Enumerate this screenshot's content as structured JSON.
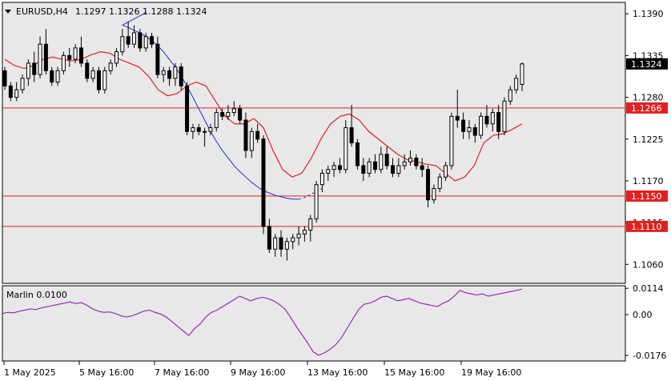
{
  "header": {
    "symbol": "EURUSD,H4",
    "ohlc": "1.1297 1.1326 1.1288 1.1324"
  },
  "colors": {
    "background": "#e8e8e8",
    "bull_candle": "#ffffff",
    "bear_candle": "#000000",
    "ma_fast": "#e02020",
    "ma_slow": "#1f2fd0",
    "level_line": "#e02020",
    "oscillator": "#9c2ab8",
    "current_price_bg": "#000000"
  },
  "chart_data": [
    {
      "type": "candlestick",
      "title": "EURUSD,H4",
      "ylim": [
        1.1035,
        1.1405
      ],
      "y_ticks": [
        "1.1390",
        "1.1335",
        "1.1280",
        "1.1225",
        "1.1170",
        "1.1115",
        "1.1060"
      ],
      "x_ticks": [
        "1 May 2025",
        "5 May 16:00",
        "7 May 16:00",
        "9 May 16:00",
        "13 May 16:00",
        "15 May 16:00",
        "19 May 16:00"
      ],
      "current_price": "1.1324",
      "levels": [
        {
          "value": 1.1266,
          "label": "1.1266"
        },
        {
          "value": 1.115,
          "label": "1.1150"
        },
        {
          "value": 1.111,
          "label": "1.1110"
        }
      ],
      "candles": [
        [
          1.1315,
          1.132,
          1.129,
          1.1295
        ],
        [
          1.1295,
          1.13,
          1.1275,
          1.128
        ],
        [
          1.128,
          1.13,
          1.1275,
          1.129
        ],
        [
          1.129,
          1.131,
          1.1285,
          1.1305
        ],
        [
          1.1305,
          1.133,
          1.1295,
          1.1325
        ],
        [
          1.1325,
          1.134,
          1.13,
          1.131
        ],
        [
          1.131,
          1.136,
          1.1305,
          1.135
        ],
        [
          1.135,
          1.137,
          1.131,
          1.1315
        ],
        [
          1.1315,
          1.132,
          1.1295,
          1.13
        ],
        [
          1.13,
          1.132,
          1.1295,
          1.1315
        ],
        [
          1.1315,
          1.134,
          1.131,
          1.1335
        ],
        [
          1.1335,
          1.1345,
          1.132,
          1.133
        ],
        [
          1.133,
          1.135,
          1.1325,
          1.1345
        ],
        [
          1.1345,
          1.136,
          1.132,
          1.1325
        ],
        [
          1.1325,
          1.133,
          1.13,
          1.1305
        ],
        [
          1.1305,
          1.132,
          1.13,
          1.1315
        ],
        [
          1.1315,
          1.132,
          1.1285,
          1.129
        ],
        [
          1.129,
          1.132,
          1.1285,
          1.1315
        ],
        [
          1.1315,
          1.133,
          1.131,
          1.1325
        ],
        [
          1.1325,
          1.1345,
          1.132,
          1.134
        ],
        [
          1.134,
          1.137,
          1.1335,
          1.136
        ],
        [
          1.136,
          1.138,
          1.1345,
          1.135
        ],
        [
          1.135,
          1.1375,
          1.1345,
          1.1365
        ],
        [
          1.1365,
          1.137,
          1.134,
          1.1345
        ],
        [
          1.1345,
          1.1365,
          1.134,
          1.136
        ],
        [
          1.136,
          1.1365,
          1.1345,
          1.135
        ],
        [
          1.135,
          1.136,
          1.1305,
          1.131
        ],
        [
          1.131,
          1.132,
          1.13,
          1.1315
        ],
        [
          1.1315,
          1.132,
          1.1295,
          1.1305
        ],
        [
          1.1305,
          1.1325,
          1.1295,
          1.132
        ],
        [
          1.132,
          1.1325,
          1.129,
          1.1295
        ],
        [
          1.1295,
          1.13,
          1.123,
          1.1235
        ],
        [
          1.1235,
          1.1245,
          1.1225,
          1.124
        ],
        [
          1.124,
          1.1245,
          1.123,
          1.1235
        ],
        [
          1.1235,
          1.124,
          1.1215,
          1.1235
        ],
        [
          1.1235,
          1.1245,
          1.123,
          1.124
        ],
        [
          1.124,
          1.1265,
          1.1235,
          1.126
        ],
        [
          1.126,
          1.1265,
          1.125,
          1.1255
        ],
        [
          1.1255,
          1.127,
          1.125,
          1.126
        ],
        [
          1.126,
          1.1275,
          1.1255,
          1.1265
        ],
        [
          1.1265,
          1.127,
          1.1245,
          1.125
        ],
        [
          1.125,
          1.126,
          1.12,
          1.121
        ],
        [
          1.121,
          1.124,
          1.12,
          1.1235
        ],
        [
          1.1235,
          1.1245,
          1.122,
          1.1225
        ],
        [
          1.1225,
          1.123,
          1.11,
          1.111
        ],
        [
          1.111,
          1.112,
          1.1075,
          1.108
        ],
        [
          1.108,
          1.11,
          1.107,
          1.1095
        ],
        [
          1.1095,
          1.1105,
          1.107,
          1.108
        ],
        [
          1.108,
          1.1095,
          1.1065,
          1.109
        ],
        [
          1.109,
          1.11,
          1.108,
          1.1095
        ],
        [
          1.1095,
          1.111,
          1.1085,
          1.11
        ],
        [
          1.11,
          1.111,
          1.109,
          1.1105
        ],
        [
          1.1105,
          1.1125,
          1.109,
          1.112
        ],
        [
          1.112,
          1.117,
          1.1115,
          1.1165
        ],
        [
          1.1165,
          1.1185,
          1.1155,
          1.118
        ],
        [
          1.118,
          1.119,
          1.117,
          1.1185
        ],
        [
          1.1185,
          1.1195,
          1.1175,
          1.119
        ],
        [
          1.119,
          1.12,
          1.118,
          1.1185
        ],
        [
          1.1185,
          1.125,
          1.118,
          1.124
        ],
        [
          1.124,
          1.127,
          1.1215,
          1.122
        ],
        [
          1.122,
          1.1225,
          1.1185,
          1.119
        ],
        [
          1.119,
          1.12,
          1.117,
          1.118
        ],
        [
          1.118,
          1.12,
          1.1175,
          1.1195
        ],
        [
          1.1195,
          1.1205,
          1.118,
          1.1185
        ],
        [
          1.1185,
          1.1215,
          1.118,
          1.1205
        ],
        [
          1.1205,
          1.1215,
          1.1185,
          1.119
        ],
        [
          1.119,
          1.12,
          1.1175,
          1.118
        ],
        [
          1.118,
          1.12,
          1.1175,
          1.119
        ],
        [
          1.119,
          1.1205,
          1.1185,
          1.1195
        ],
        [
          1.1195,
          1.121,
          1.119,
          1.12
        ],
        [
          1.12,
          1.1205,
          1.1185,
          1.119
        ],
        [
          1.119,
          1.12,
          1.1175,
          1.1185
        ],
        [
          1.1185,
          1.119,
          1.1135,
          1.1145
        ],
        [
          1.1145,
          1.1165,
          1.114,
          1.116
        ],
        [
          1.116,
          1.118,
          1.1155,
          1.1175
        ],
        [
          1.1175,
          1.1195,
          1.117,
          1.119
        ],
        [
          1.119,
          1.126,
          1.1185,
          1.1255
        ],
        [
          1.1255,
          1.129,
          1.124,
          1.125
        ],
        [
          1.125,
          1.126,
          1.1225,
          1.1235
        ],
        [
          1.1235,
          1.125,
          1.1225,
          1.124
        ],
        [
          1.124,
          1.1245,
          1.122,
          1.123
        ],
        [
          1.123,
          1.126,
          1.1225,
          1.1255
        ],
        [
          1.1255,
          1.127,
          1.124,
          1.1245
        ],
        [
          1.1245,
          1.1265,
          1.1235,
          1.126
        ],
        [
          1.126,
          1.127,
          1.1225,
          1.1235
        ],
        [
          1.1235,
          1.128,
          1.123,
          1.1275
        ],
        [
          1.1275,
          1.1295,
          1.127,
          1.129
        ],
        [
          1.129,
          1.131,
          1.1285,
          1.1305
        ],
        [
          1.1297,
          1.1326,
          1.1288,
          1.1324
        ]
      ],
      "ma_fast": [
        1.133,
        1.1322,
        1.1318,
        1.1322,
        1.133,
        1.1333,
        1.133,
        1.1328,
        1.133,
        1.1336,
        1.134,
        1.1338,
        1.133,
        1.1325,
        1.132,
        1.1308,
        1.129,
        1.1282,
        1.1285,
        1.1295,
        1.13,
        1.1295,
        1.1275,
        1.1255,
        1.1245,
        1.1245,
        1.1252,
        1.124,
        1.121,
        1.1185,
        1.1175,
        1.118,
        1.12,
        1.1225,
        1.1245,
        1.1255,
        1.1258,
        1.125,
        1.1235,
        1.1225,
        1.1215,
        1.1205,
        1.1198,
        1.1195,
        1.1192,
        1.119,
        1.118,
        1.117,
        1.1175,
        1.119,
        1.122,
        1.123,
        1.1232,
        1.1238,
        1.1245
      ],
      "ma_fast_start": 0,
      "ma_slow": [
        1.1375,
        1.1372,
        1.1368,
        1.1365,
        1.136,
        1.1355,
        1.1348,
        1.134,
        1.133,
        1.132,
        1.1308,
        1.1295,
        1.128,
        1.1265,
        1.125,
        1.1235,
        1.1222,
        1.121,
        1.12,
        1.119,
        1.1182,
        1.1175,
        1.1168,
        1.1162,
        1.1157,
        1.1154,
        1.1151,
        1.1149,
        1.1147,
        1.1146,
        1.1146,
        1.1148,
        1.1152,
        1.1156,
        1.116
      ],
      "ma_slow_start": 20,
      "ma_slow_dashed_from": 30
    },
    {
      "type": "line",
      "title": "Marlin 0.0100",
      "ylim": [
        -0.02,
        0.0125
      ],
      "y_ticks": [
        "0.0114",
        "0.00",
        "-0.0176"
      ],
      "values": [
        0.0005,
        0.001,
        0.0008,
        0.0015,
        0.002,
        0.0025,
        0.0022,
        0.003,
        0.0035,
        0.004,
        0.0045,
        0.005,
        0.0055,
        0.0048,
        0.0052,
        0.004,
        0.0025,
        0.0015,
        0.001,
        0.0012,
        0.0005,
        -0.0005,
        -0.001,
        -0.0005,
        0.0005,
        0.0015,
        0.002,
        0.001,
        0.0003,
        -0.001,
        -0.003,
        -0.005,
        -0.007,
        -0.009,
        -0.006,
        -0.004,
        -0.001,
        0.001,
        0.002,
        0.0035,
        0.005,
        0.0065,
        0.008,
        0.007,
        0.006,
        0.007,
        0.0075,
        0.007,
        0.006,
        0.0045,
        0.0025,
        -0.001,
        -0.005,
        -0.0085,
        -0.012,
        -0.016,
        -0.0175,
        -0.0165,
        -0.015,
        -0.013,
        -0.01,
        -0.006,
        -0.002,
        0.002,
        0.0045,
        0.005,
        0.006,
        0.0075,
        0.008,
        0.007,
        0.006,
        0.0065,
        0.007,
        0.006,
        0.005,
        0.0045,
        0.004,
        0.0035,
        0.005,
        0.006,
        0.008,
        0.0105,
        0.0095,
        0.009,
        0.0085,
        0.009,
        0.008,
        0.0085,
        0.009,
        0.0095,
        0.01,
        0.0105,
        0.011
      ]
    }
  ]
}
